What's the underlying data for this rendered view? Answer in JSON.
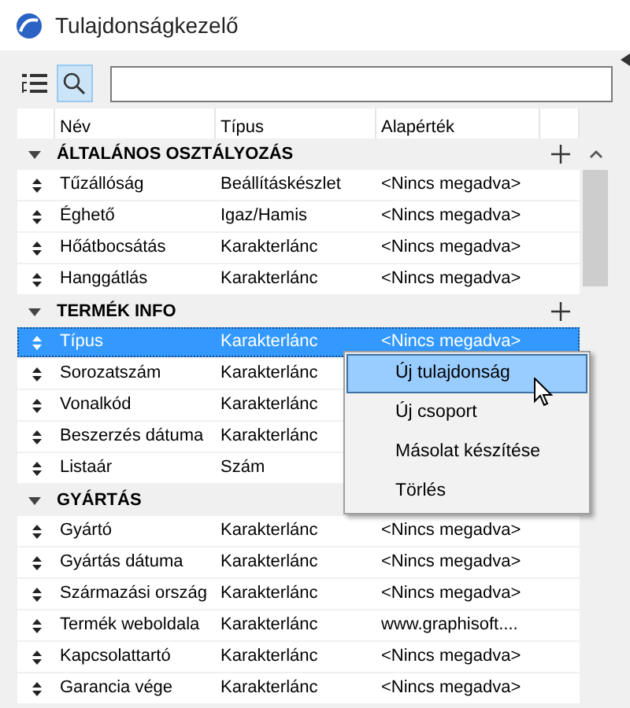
{
  "window": {
    "title": "Tulajdonságkezelő"
  },
  "toolbar": {
    "buttons": [
      {
        "kind": "tree",
        "selected": false
      },
      {
        "kind": "search",
        "selected": true
      }
    ]
  },
  "table": {
    "columns": [
      "Név",
      "Típus",
      "Alapérték"
    ],
    "groups": [
      {
        "name": "ÁLTALÁNOS OSZTÁLYOZÁS",
        "expanded": true,
        "add_button": true,
        "rows": [
          {
            "name": "Tűzállóság",
            "type": "Beállításkészlet",
            "default": "<Nincs megadva>",
            "selected": false
          },
          {
            "name": "Éghető",
            "type": "Igaz/Hamis",
            "default": "<Nincs megadva>",
            "selected": false
          },
          {
            "name": "Hőátbocsátás",
            "type": "Karakterlánc",
            "default": "<Nincs megadva>",
            "selected": false
          },
          {
            "name": "Hanggátlás",
            "type": "Karakterlánc",
            "default": "<Nincs megadva>",
            "selected": false
          }
        ]
      },
      {
        "name": "TERMÉK INFO",
        "expanded": true,
        "add_button": true,
        "rows": [
          {
            "name": "Típus",
            "type": "Karakterlánc",
            "default": "<Nincs megadva>",
            "selected": true
          },
          {
            "name": "Sorozatszám",
            "type": "Karakterlánc",
            "selected": false
          },
          {
            "name": "Vonalkód",
            "type": "Karakterlánc",
            "selected": false
          },
          {
            "name": "Beszerzés dátuma",
            "type": "Karakterlánc",
            "selected": false
          },
          {
            "name": "Listaár",
            "type": "Szám",
            "selected": false
          }
        ]
      },
      {
        "name": "GYÁRTÁS",
        "expanded": true,
        "add_button": false,
        "rows": [
          {
            "name": "Gyártó",
            "type": "Karakterlánc",
            "default": "<Nincs megadva>",
            "selected": false
          },
          {
            "name": "Gyártás dátuma",
            "type": "Karakterlánc",
            "default": "<Nincs megadva>",
            "selected": false
          },
          {
            "name": "Származási ország",
            "type": "Karakterlánc",
            "default": "<Nincs megadva>",
            "selected": false
          },
          {
            "name": "Termék weboldala",
            "type": "Karakterlánc",
            "default": "www.graphisoft....",
            "selected": false
          },
          {
            "name": "Kapcsolattartó",
            "type": "Karakterlánc",
            "default": "<Nincs megadva>",
            "selected": false
          },
          {
            "name": "Garancia vége",
            "type": "Karakterlánc",
            "default": "<Nincs megadva>",
            "selected": false
          }
        ]
      }
    ]
  },
  "context_menu": {
    "items": [
      {
        "label": "Új tulajdonság",
        "selected": true
      },
      {
        "label": "Új csoport",
        "selected": false
      },
      {
        "label": "Másolat készítése",
        "selected": false
      },
      {
        "label": "Törlés",
        "selected": false
      }
    ]
  }
}
